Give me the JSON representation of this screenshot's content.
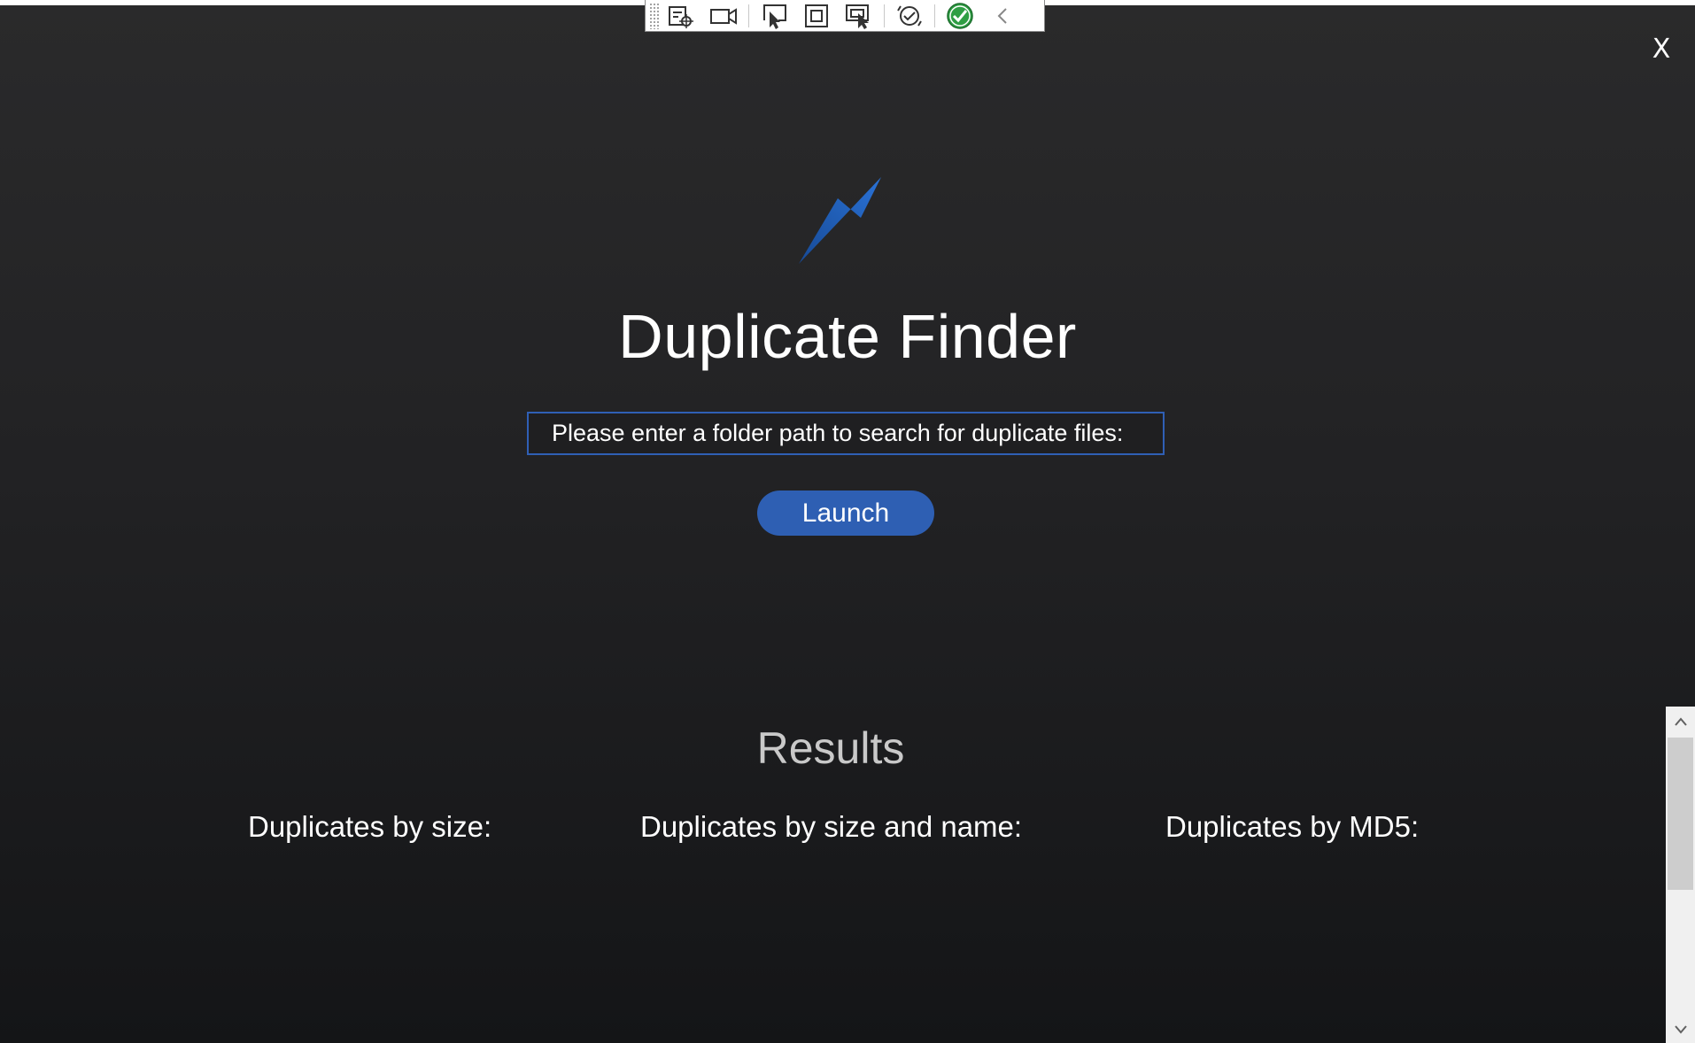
{
  "window": {
    "close_label": "X"
  },
  "toolbar": {
    "icons": [
      "live-visual-tree-icon",
      "record-icon",
      "select-element-icon",
      "display-layout-adorners-icon",
      "track-focused-element-icon",
      "hot-reload-icon",
      "binding-failures-ok-icon",
      "collapse-chevron-icon"
    ]
  },
  "app": {
    "title": "Duplicate Finder",
    "accent_color": "#2e5fb3"
  },
  "search": {
    "placeholder": "Please enter a folder path to search for duplicate files:",
    "value": ""
  },
  "actions": {
    "launch_label": "Launch"
  },
  "results": {
    "title": "Results",
    "columns": [
      {
        "label": "Duplicates by size:"
      },
      {
        "label": "Duplicates by size and name:"
      },
      {
        "label": "Duplicates by MD5:"
      }
    ]
  }
}
